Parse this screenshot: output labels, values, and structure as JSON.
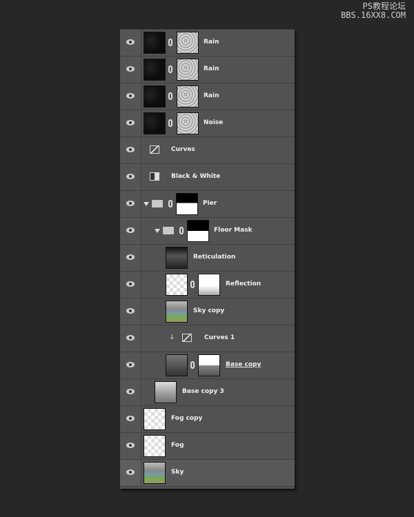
{
  "watermark": {
    "line1": "PS教程论坛",
    "line2": "BBS.16XX8.COM"
  },
  "layers": [
    {
      "name": "Rain",
      "visible": true
    },
    {
      "name": "Rain",
      "visible": true
    },
    {
      "name": "Rain",
      "visible": true
    },
    {
      "name": "Noise",
      "visible": true
    },
    {
      "name": "Curves",
      "visible": true
    },
    {
      "name": "Black & White",
      "visible": true
    },
    {
      "name": "Pier",
      "visible": true,
      "group": "expanded"
    },
    {
      "name": "Floor Mask",
      "visible": true,
      "group": "expanded"
    },
    {
      "name": "Reticulation",
      "visible": true
    },
    {
      "name": "Reflection",
      "visible": true
    },
    {
      "name": "Sky copy",
      "visible": true
    },
    {
      "name": "Curves 1",
      "visible": true,
      "clipped": true
    },
    {
      "name": "Base copy",
      "visible": true
    },
    {
      "name": "Base copy 3",
      "visible": true
    },
    {
      "name": "Fog copy",
      "visible": true
    },
    {
      "name": "Fog",
      "visible": true
    },
    {
      "name": "Sky",
      "visible": true,
      "selected": true
    }
  ]
}
